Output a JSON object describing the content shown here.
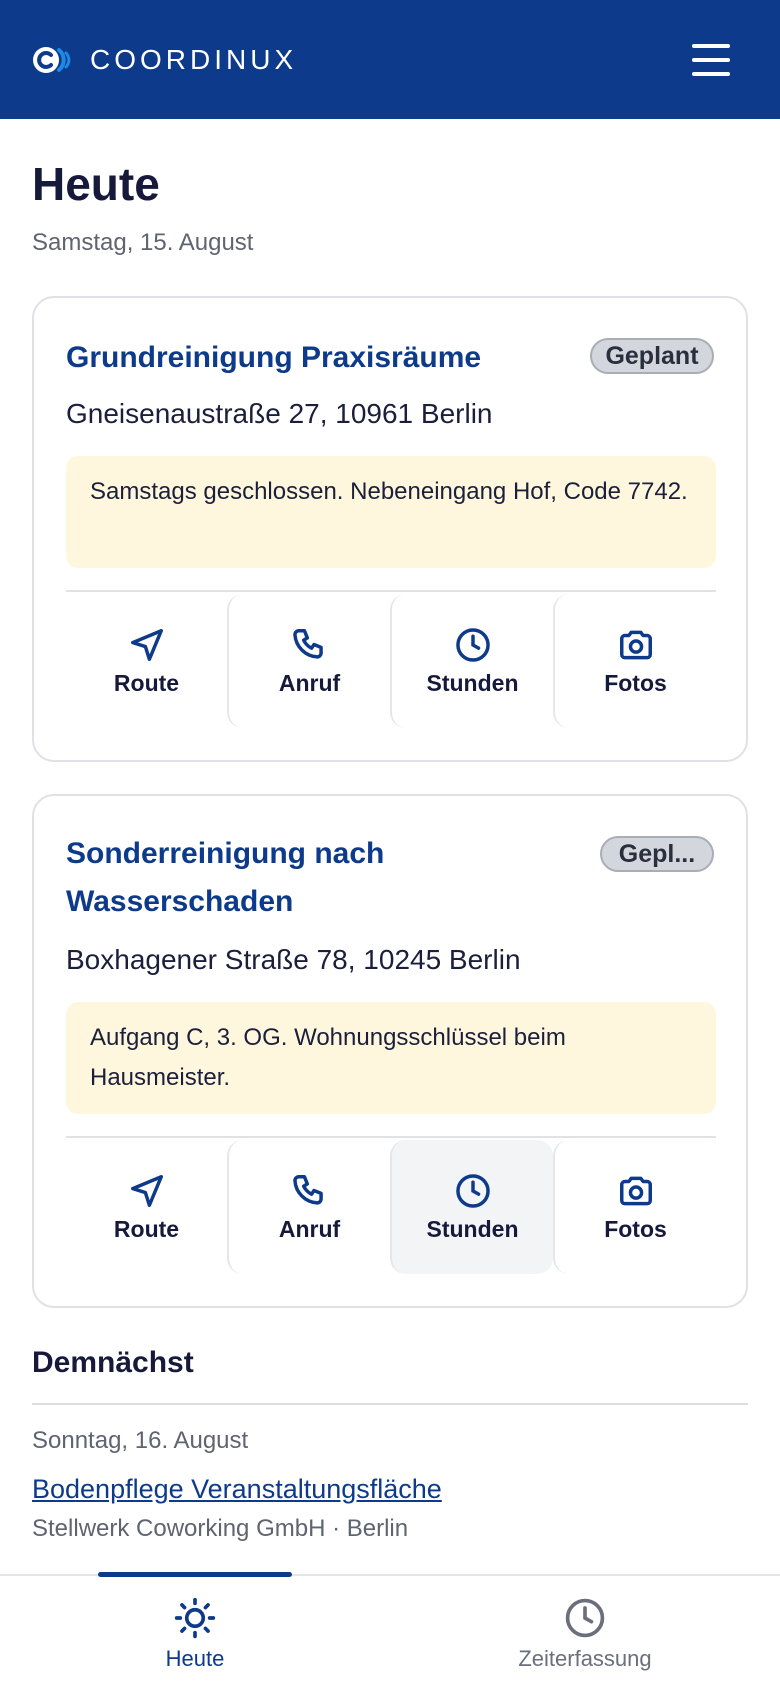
{
  "app": {
    "brand": "COORDINUX",
    "colors": {
      "primary": "#0d3a8a",
      "note_bg": "#fff7dd",
      "badge_bg": "#d3d6dd"
    }
  },
  "page": {
    "title": "Heute",
    "date": "Samstag, 15. August"
  },
  "jobs": [
    {
      "title": "Grundreinigung Praxisräume",
      "status": "Geplant",
      "address": "Gneisenaustraße 27, 10961 Berlin",
      "note": "Samstags geschlossen. Nebeneingang Hof, Code 7742."
    },
    {
      "title": "Sonderreinigung nach Wasserschaden",
      "status": "Gepl...",
      "address": "Boxhagener Straße 78, 10245 Berlin",
      "note": "Aufgang C, 3. OG. Wohnungsschlüssel beim Hausmeister."
    }
  ],
  "actions": [
    {
      "label": "Route",
      "icon": "navigation-arrow-icon"
    },
    {
      "label": "Anruf",
      "icon": "phone-icon"
    },
    {
      "label": "Stunden",
      "icon": "clock-icon"
    },
    {
      "label": "Fotos",
      "icon": "camera-icon"
    }
  ],
  "upcoming": {
    "title": "Demnächst",
    "date": "Sonntag, 16. August",
    "job_title": "Bodenpflege Veranstaltungsfläche",
    "client": "Stellwerk Coworking GmbH · Berlin"
  },
  "nav": [
    {
      "label": "Heute",
      "icon": "sun-icon",
      "active": true
    },
    {
      "label": "Zeiterfassung",
      "icon": "clock-icon",
      "active": false
    }
  ]
}
